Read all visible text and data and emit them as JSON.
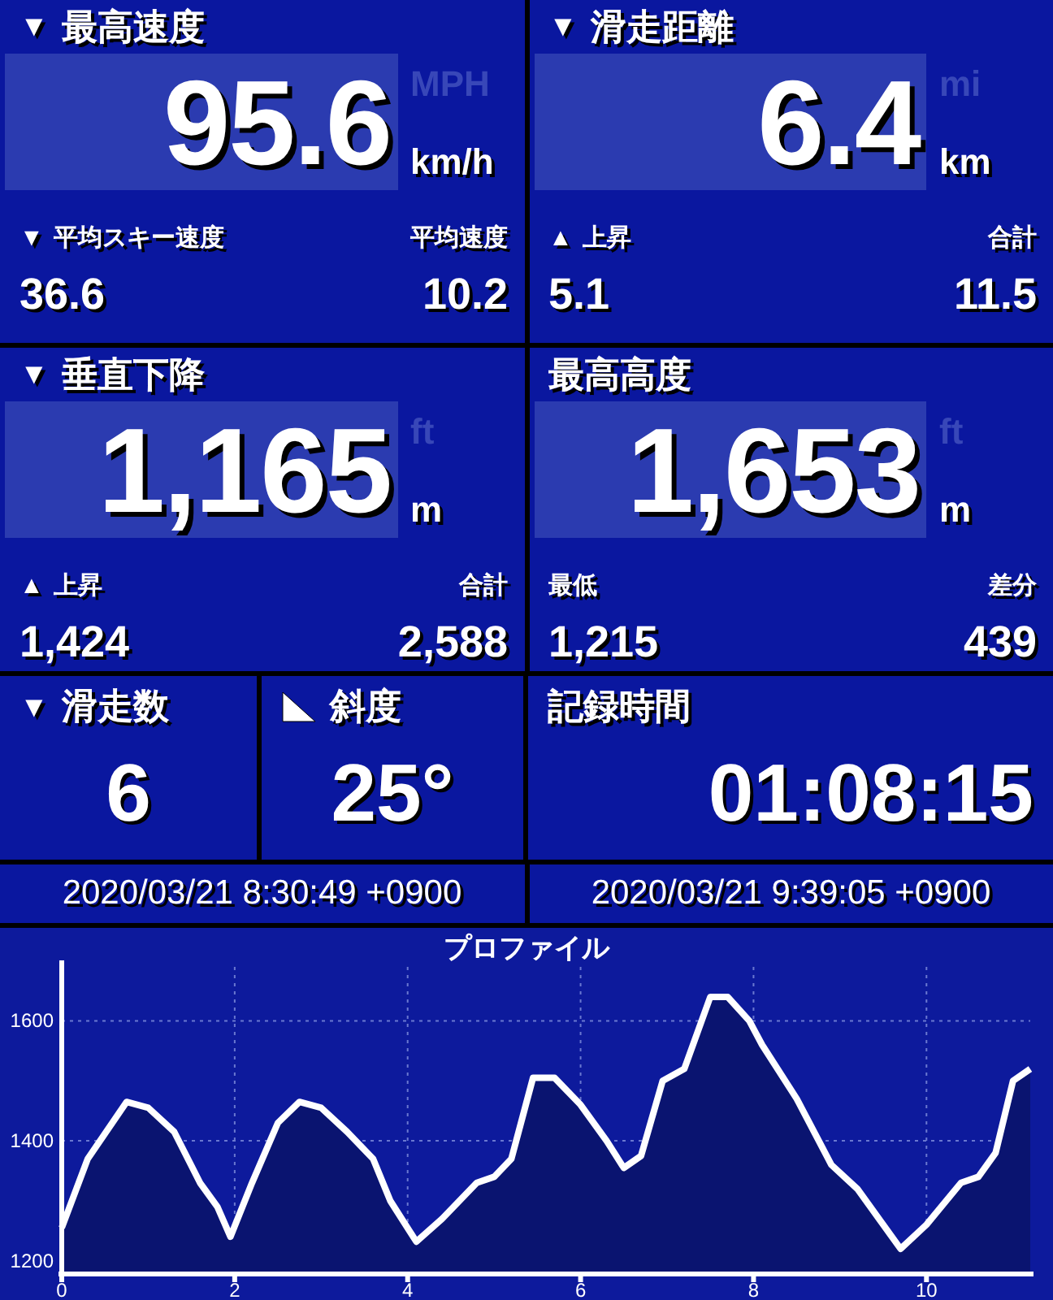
{
  "panels": [
    {
      "marker": "▼",
      "title": "最高速度",
      "value": "95.6",
      "units": [
        {
          "label": "MPH",
          "selected": false
        },
        {
          "label": "km/h",
          "selected": true
        }
      ],
      "sub_left": {
        "marker": "▼",
        "label": "平均スキー速度",
        "value": "36.6"
      },
      "sub_right": {
        "label": "平均速度",
        "value": "10.2"
      }
    },
    {
      "marker": "▼",
      "title": "滑走距離",
      "value": "6.4",
      "units": [
        {
          "label": "mi",
          "selected": false
        },
        {
          "label": "km",
          "selected": true
        }
      ],
      "sub_left": {
        "marker": "▲",
        "label": "上昇",
        "value": "5.1"
      },
      "sub_right": {
        "label": "合計",
        "value": "11.5"
      }
    },
    {
      "marker": "▼",
      "title": "垂直下降",
      "value": "1,165",
      "units": [
        {
          "label": "ft",
          "selected": false
        },
        {
          "label": "m",
          "selected": true
        }
      ],
      "sub_left": {
        "marker": "▲",
        "label": "上昇",
        "value": "1,424"
      },
      "sub_right": {
        "label": "合計",
        "value": "2,588"
      }
    },
    {
      "title": "最高高度",
      "value": "1,653",
      "units": [
        {
          "label": "ft",
          "selected": false
        },
        {
          "label": "m",
          "selected": true
        }
      ],
      "sub_left": {
        "label": "最低",
        "value": "1,215"
      },
      "sub_right": {
        "label": "差分",
        "value": "439"
      }
    }
  ],
  "small_panels": [
    {
      "marker": "▼",
      "kind": "glyph",
      "title": "滑走数",
      "value": "6"
    },
    {
      "kind": "slope",
      "title": "斜度",
      "value": "25°"
    },
    {
      "title": "記録時間",
      "value": "01:08:15"
    }
  ],
  "timestamps": [
    "2020/03/21 8:30:49 +0900",
    "2020/03/21 9:39:05 +0900"
  ],
  "profile": {
    "chart_data": {
      "type": "area",
      "title": "プロファイル",
      "x": [
        0,
        0.3,
        0.75,
        1.0,
        1.3,
        1.6,
        1.8,
        1.95,
        2.2,
        2.5,
        2.75,
        3.0,
        3.3,
        3.6,
        3.8,
        4.1,
        4.4,
        4.8,
        5.0,
        5.2,
        5.45,
        5.7,
        6.0,
        6.3,
        6.5,
        6.7,
        6.95,
        7.2,
        7.5,
        7.7,
        7.95,
        8.1,
        8.5,
        8.9,
        9.2,
        9.7,
        10.0,
        10.4,
        10.6,
        10.8,
        11.0,
        11.2
      ],
      "series": [
        {
          "color": "#ffffff",
          "values": [
            1255,
            1370,
            1465,
            1455,
            1415,
            1330,
            1290,
            1240,
            1330,
            1430,
            1465,
            1455,
            1415,
            1370,
            1300,
            1232,
            1270,
            1330,
            1340,
            1370,
            1505,
            1505,
            1460,
            1400,
            1355,
            1375,
            1500,
            1520,
            1640,
            1640,
            1600,
            1560,
            1470,
            1360,
            1320,
            1220,
            1260,
            1330,
            1340,
            1380,
            1500,
            1520
          ]
        }
      ],
      "xlim": [
        0,
        11.2
      ],
      "ylim": [
        1178,
        1690
      ],
      "xticks": [
        0,
        2,
        4,
        6,
        8,
        10
      ],
      "yticks": [
        1200,
        1400,
        1600
      ],
      "grid": true
    }
  }
}
